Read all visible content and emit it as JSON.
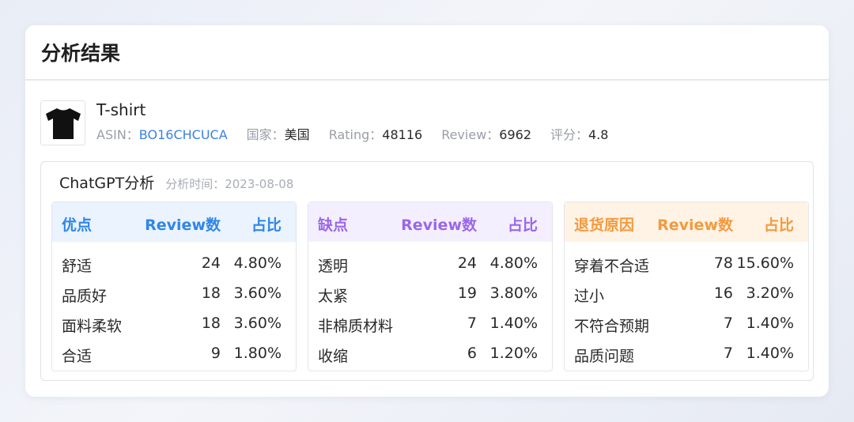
{
  "page_title": "分析结果",
  "product": {
    "name": "T-shirt",
    "asin_label": "ASIN：",
    "asin": "BO16CHCUCA",
    "country_label": "国家：",
    "country": "美国",
    "rating_label": "Rating：",
    "rating": "48116",
    "review_label": "Review：",
    "review": "6962",
    "score_label": "评分：",
    "score": "4.8"
  },
  "analysis": {
    "title": "ChatGPT分析",
    "time_label": "分析时间：",
    "time": "2023-08-08"
  },
  "panels": [
    {
      "header": [
        "优点",
        "Review数",
        "占比"
      ],
      "rows": [
        [
          "舒适",
          "24",
          "4.80%"
        ],
        [
          "品质好",
          "18",
          "3.60%"
        ],
        [
          "面料柔软",
          "18",
          "3.60%"
        ],
        [
          "合适",
          "9",
          "1.80%"
        ]
      ]
    },
    {
      "header": [
        "缺点",
        "Review数",
        "占比"
      ],
      "rows": [
        [
          "透明",
          "24",
          "4.80%"
        ],
        [
          "太紧",
          "19",
          "3.80%"
        ],
        [
          "非棉质材料",
          "7",
          "1.40%"
        ],
        [
          "收缩",
          "6",
          "1.20%"
        ]
      ]
    },
    {
      "header": [
        "退货原因",
        "Review数",
        "占比"
      ],
      "rows": [
        [
          "穿着不合适",
          "78",
          "15.60%"
        ],
        [
          "过小",
          "16",
          "3.20%"
        ],
        [
          "不符合预期",
          "7",
          "1.40%"
        ],
        [
          "品质问题",
          "7",
          "1.40%"
        ]
      ]
    }
  ],
  "colors": {
    "pros": "#2f86e8",
    "cons": "#9a67ea",
    "returns": "#f59a3c",
    "link": "#3b82e6"
  },
  "icons": {
    "product_thumbnail": "tshirt-icon"
  }
}
